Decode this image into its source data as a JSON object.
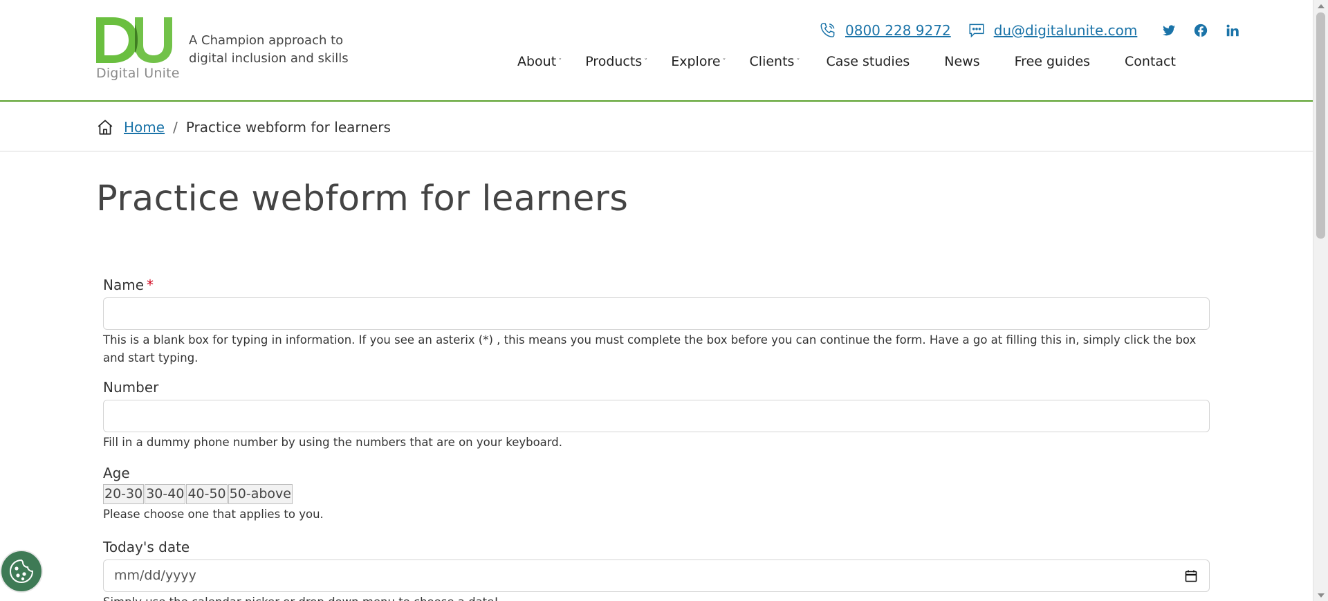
{
  "brand": {
    "logo_letters": "DU",
    "logo_name": "Digital Unite",
    "tagline": "A Champion approach to digital inclusion and skills",
    "colors": {
      "green": "#6abf3f",
      "dark_green": "#4e8f2b",
      "link": "#1a73a8",
      "required": "#d0021b",
      "cookie_bg": "#3e7a55"
    }
  },
  "contact": {
    "phone": "0800 228 9272",
    "email": "du@digitalunite.com",
    "phone_icon": "phone-icon",
    "email_icon": "chat-icon"
  },
  "social": [
    "twitter-icon",
    "facebook-icon",
    "linkedin-icon"
  ],
  "nav": {
    "items": [
      {
        "label": "About",
        "has_dropdown": true
      },
      {
        "label": "Products",
        "has_dropdown": true
      },
      {
        "label": "Explore",
        "has_dropdown": true
      },
      {
        "label": "Clients",
        "has_dropdown": true
      },
      {
        "label": "Case studies",
        "has_dropdown": false
      },
      {
        "label": "News",
        "has_dropdown": false
      },
      {
        "label": "Free guides",
        "has_dropdown": false
      },
      {
        "label": "Contact",
        "has_dropdown": false
      }
    ]
  },
  "breadcrumb": {
    "home_label": "Home",
    "separator": "/",
    "current": "Practice webform for learners"
  },
  "page": {
    "title": "Practice webform for learners"
  },
  "form": {
    "name": {
      "label": "Name",
      "required_mark": "*",
      "value": "",
      "help": "This is a blank box for typing in information. If you see an asterix (*) , this means you must complete the box before you can continue the form. Have a go at filling this in, simply click the box and start typing."
    },
    "number": {
      "label": "Number",
      "value": "",
      "help": "Fill in a dummy phone number by using the numbers that are on your keyboard."
    },
    "age": {
      "label": "Age",
      "options": [
        "20-30",
        "30-40",
        "40-50",
        "50-above"
      ],
      "help": "Please choose one that applies to you."
    },
    "date": {
      "label": "Today's date",
      "placeholder": "mm/dd/yyyy",
      "help": "Simply use the calendar picker or drop down menu to choose a date!"
    }
  },
  "cookie": {
    "icon": "cookie-icon"
  }
}
